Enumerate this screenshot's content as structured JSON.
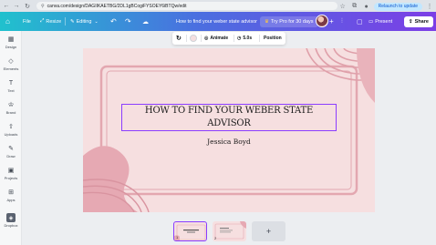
{
  "browser": {
    "url": "canva.com/design/DAGIIKAETBG/2DL1gBCogiFYSOEY6iBTQw/edit",
    "relaunch_label": "Relaunch to update"
  },
  "topbar": {
    "file_label": "File",
    "resize_label": "Resize",
    "editing_label": "Editing",
    "doc_title": "How to find your weber state advisor",
    "try_pro_label": "Try Pro for 30 days",
    "present_label": "Present",
    "share_label": "Share"
  },
  "sidebar": {
    "items": [
      {
        "label": "Design",
        "icon": "design-icon"
      },
      {
        "label": "Elements",
        "icon": "elements-icon"
      },
      {
        "label": "Text",
        "icon": "text-icon"
      },
      {
        "label": "Brand",
        "icon": "brand-icon"
      },
      {
        "label": "Uploads",
        "icon": "uploads-icon"
      },
      {
        "label": "Draw",
        "icon": "draw-icon"
      },
      {
        "label": "Projects",
        "icon": "projects-icon"
      },
      {
        "label": "Apps",
        "icon": "apps-icon"
      },
      {
        "label": "Dropbox",
        "icon": "dropbox-icon"
      }
    ]
  },
  "context_toolbar": {
    "animate_label": "Animate",
    "duration_label": "5.0s",
    "position_label": "Position"
  },
  "slide": {
    "title": "HOW TO FIND YOUR WEBER STATE ADVISOR",
    "subtitle": "Jessica Boyd",
    "background_color": "#f6dfe0",
    "accent_color": "#e3a7b0",
    "selection_color": "#8b3dff"
  },
  "pages": {
    "thumbnails": [
      {
        "number": "1",
        "selected": true
      },
      {
        "number": "2",
        "selected": false
      }
    ],
    "add_label": "+"
  }
}
